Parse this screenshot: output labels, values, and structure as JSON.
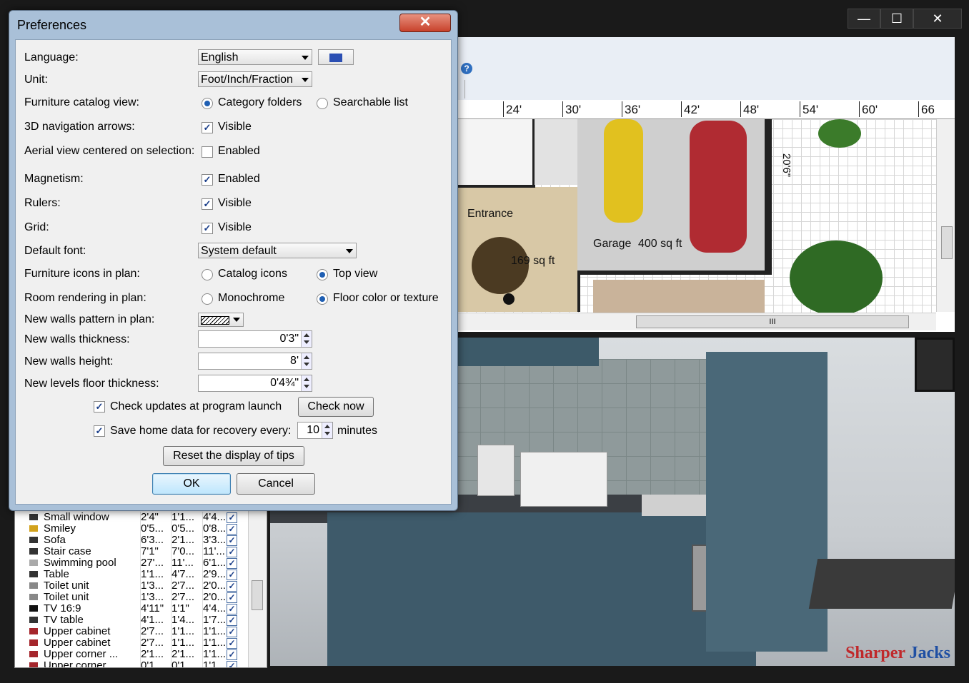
{
  "window": {
    "min_label": "—",
    "max_label": "☐",
    "close_label": "✕"
  },
  "toolbar": {
    "help_label": "?"
  },
  "plan": {
    "ruler_ticks": [
      "24'",
      "30'",
      "36'",
      "42'",
      "48'",
      "54'",
      "60'",
      "66"
    ],
    "rooms": [
      {
        "label": "Entrance"
      },
      {
        "label": "169 sq ft"
      },
      {
        "label": "Garage"
      },
      {
        "label": "400 sq ft"
      }
    ],
    "dimension_label": "20'6\"",
    "hscroll_grip": "III"
  },
  "furniture": [
    {
      "name": "Small window",
      "w": "2'4\"",
      "d": "1'1...",
      "h": "4'4...",
      "visible": true
    },
    {
      "name": "Smiley",
      "w": "0'5...",
      "d": "0'5...",
      "h": "0'8...",
      "visible": true
    },
    {
      "name": "Sofa",
      "w": "6'3...",
      "d": "2'1...",
      "h": "3'3...",
      "visible": true
    },
    {
      "name": "Stair case",
      "w": "7'1\"",
      "d": "7'0...",
      "h": "11'...",
      "visible": true
    },
    {
      "name": "Swimming pool",
      "w": "27'...",
      "d": "11'...",
      "h": "6'1...",
      "visible": true
    },
    {
      "name": "Table",
      "w": "1'1...",
      "d": "4'7...",
      "h": "2'9...",
      "visible": true
    },
    {
      "name": "Toilet unit",
      "w": "1'3...",
      "d": "2'7...",
      "h": "2'0...",
      "visible": true
    },
    {
      "name": "Toilet unit",
      "w": "1'3...",
      "d": "2'7...",
      "h": "2'0...",
      "visible": true
    },
    {
      "name": "TV 16:9",
      "w": "4'11\"",
      "d": "1'1\"",
      "h": "4'4...",
      "visible": true
    },
    {
      "name": "TV table",
      "w": "4'1...",
      "d": "1'4...",
      "h": "1'7...",
      "visible": true
    },
    {
      "name": "Upper cabinet",
      "w": "2'7...",
      "d": "1'1...",
      "h": "1'1...",
      "visible": true
    },
    {
      "name": "Upper cabinet",
      "w": "2'7...",
      "d": "1'1...",
      "h": "1'1...",
      "visible": true
    },
    {
      "name": "Upper corner ...",
      "w": "2'1...",
      "d": "2'1...",
      "h": "1'1...",
      "visible": true
    },
    {
      "name": "Upper corner ...",
      "w": "0'1...",
      "d": "0'1...",
      "h": "1'1...",
      "visible": true
    }
  ],
  "view3d": {
    "watermark_a": "Sharper",
    "watermark_b": "Jacks"
  },
  "dialog": {
    "title": "Preferences",
    "close_label": "✕",
    "language_label": "Language:",
    "language_value": "English",
    "unit_label": "Unit:",
    "unit_value": "Foot/Inch/Fraction",
    "catalog_label": "Furniture catalog view:",
    "catalog_opt1": "Category folders",
    "catalog_opt2": "Searchable list",
    "nav_label": "3D navigation arrows:",
    "nav_opt": "Visible",
    "aerial_label": "Aerial view centered on selection:",
    "aerial_opt": "Enabled",
    "magnetism_label": "Magnetism:",
    "magnetism_opt": "Enabled",
    "rulers_label": "Rulers:",
    "rulers_opt": "Visible",
    "grid_label": "Grid:",
    "grid_opt": "Visible",
    "font_label": "Default font:",
    "font_value": "System default",
    "icons_label": "Furniture icons in plan:",
    "icons_opt1": "Catalog icons",
    "icons_opt2": "Top view",
    "room_label": "Room rendering in plan:",
    "room_opt1": "Monochrome",
    "room_opt2": "Floor color or texture",
    "pattern_label": "New walls pattern in plan:",
    "thickness_label": "New walls thickness:",
    "thickness_value": "0'3\"",
    "height_label": "New walls height:",
    "height_value": "8'",
    "floor_label": "New levels floor thickness:",
    "floor_value": "0'4¾\"",
    "updates_label": "Check updates at program launch",
    "check_now": "Check now",
    "recovery_label": "Save home data for recovery every:",
    "recovery_value": "10",
    "recovery_unit": "minutes",
    "reset_tips": "Reset the display of tips",
    "ok": "OK",
    "cancel": "Cancel"
  }
}
